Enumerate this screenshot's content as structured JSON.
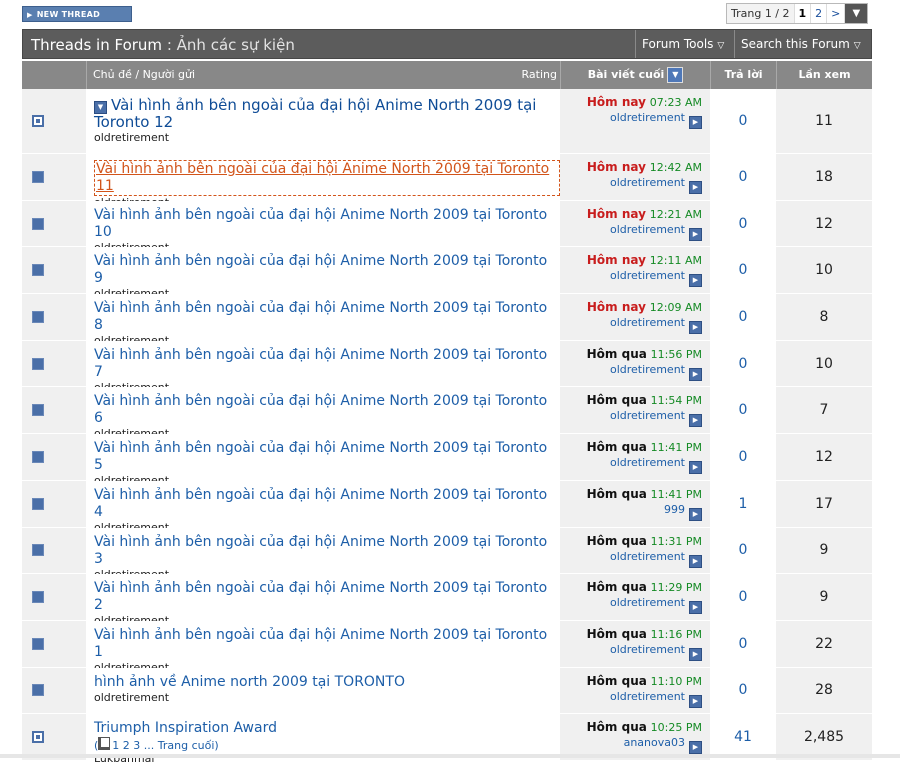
{
  "toolbar": {
    "new_thread_label": "NEW THREAD"
  },
  "pager": {
    "label": "Trang 1 / 2",
    "current": "1",
    "page2": "2",
    "next": ">",
    "dropdown": "▼"
  },
  "header": {
    "title": "Threads in Forum",
    "separator": ":",
    "forum_name": "Ảnh các sự kiện",
    "forum_tools": "Forum Tools",
    "search_forum": "Search this Forum"
  },
  "columns": {
    "topic": "Chủ đề / Người gửi",
    "rating": "Rating",
    "last_post": "Bài viết cuối",
    "replies": "Trả lời",
    "views": "Lần xem"
  },
  "threads": [
    {
      "title": "Vài hình ảnh bên ngoài của đại hội Anime North 2009 tại Toronto 12",
      "author": "oldretirement",
      "day": "Hôm nay",
      "time": "07:23 AM",
      "poster": "oldretirement",
      "replies": "0",
      "views": "11"
    },
    {
      "title": "Vài hình ảnh bên ngoài của đại hội Anime North 2009 tại Toronto 11",
      "author": "oldretirement",
      "day": "Hôm nay",
      "time": "12:42 AM",
      "poster": "oldretirement",
      "replies": "0",
      "views": "18"
    },
    {
      "title": "Vài hình ảnh bên ngoài của đại hội Anime North 2009 tại Toronto 10",
      "author": "oldretirement",
      "day": "Hôm nay",
      "time": "12:21 AM",
      "poster": "oldretirement",
      "replies": "0",
      "views": "12"
    },
    {
      "title": "Vài hình ảnh bên ngoài của đại hội Anime North 2009 tại Toronto 9",
      "author": "oldretirement",
      "day": "Hôm nay",
      "time": "12:11 AM",
      "poster": "oldretirement",
      "replies": "0",
      "views": "10"
    },
    {
      "title": "Vài hình ảnh bên ngoài của đại hội Anime North 2009 tại Toronto 8",
      "author": "oldretirement",
      "day": "Hôm nay",
      "time": "12:09 AM",
      "poster": "oldretirement",
      "replies": "0",
      "views": "8"
    },
    {
      "title": "Vài hình ảnh bên ngoài của đại hội Anime North 2009 tại Toronto 7",
      "author": "oldretirement",
      "day": "Hôm qua",
      "time": "11:56 PM",
      "poster": "oldretirement",
      "replies": "0",
      "views": "10"
    },
    {
      "title": "Vài hình ảnh bên ngoài của đại hội Anime North 2009 tại Toronto 6",
      "author": "oldretirement",
      "day": "Hôm qua",
      "time": "11:54 PM",
      "poster": "oldretirement",
      "replies": "0",
      "views": "7"
    },
    {
      "title": "Vài hình ảnh bên ngoài của đại hội Anime North 2009 tại Toronto 5",
      "author": "oldretirement",
      "day": "Hôm qua",
      "time": "11:41 PM",
      "poster": "oldretirement",
      "replies": "0",
      "views": "12"
    },
    {
      "title": "Vài hình ảnh bên ngoài của đại hội Anime North 2009 tại Toronto 4",
      "author": "oldretirement",
      "day": "Hôm qua",
      "time": "11:41 PM",
      "poster": "999",
      "replies": "1",
      "views": "17"
    },
    {
      "title": "Vài hình ảnh bên ngoài của đại hội Anime North 2009 tại Toronto 3",
      "author": "oldretirement",
      "day": "Hôm qua",
      "time": "11:31 PM",
      "poster": "oldretirement",
      "replies": "0",
      "views": "9"
    },
    {
      "title": "Vài hình ảnh bên ngoài của đại hội Anime North 2009 tại Toronto 2",
      "author": "oldretirement",
      "day": "Hôm qua",
      "time": "11:29 PM",
      "poster": "oldretirement",
      "replies": "0",
      "views": "9"
    },
    {
      "title": "Vài hình ảnh bên ngoài của đại hội Anime North 2009 tại Toronto 1",
      "author": "oldretirement",
      "day": "Hôm qua",
      "time": "11:16 PM",
      "poster": "oldretirement",
      "replies": "0",
      "views": "22"
    },
    {
      "title": "hình ảnh về Anime north 2009 tại TORONTO",
      "author": "oldretirement",
      "day": "Hôm qua",
      "time": "11:10 PM",
      "poster": "oldretirement",
      "replies": "0",
      "views": "28"
    },
    {
      "title": "Triumph Inspiration Award",
      "author": "Lukbanmai",
      "day": "Hôm qua",
      "time": "10:25 PM",
      "poster": "ananova03",
      "replies": "41",
      "views": "2,485",
      "page_links": "1 2 3 ... Trang cuối"
    }
  ],
  "colors": {
    "header_bg": "#5c5c5c",
    "colhead_bg": "#888888",
    "link": "#1d5ea8",
    "today": "#c81d1d",
    "time": "#148a24"
  }
}
